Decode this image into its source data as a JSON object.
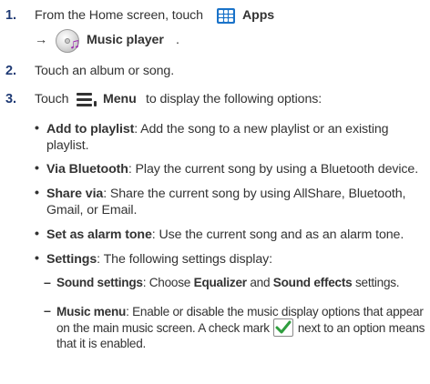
{
  "steps": [
    {
      "num": "1.",
      "pre": "From the Home screen, touch",
      "apps": "Apps",
      "arrow": "→",
      "music": "Music player",
      "end": "."
    },
    {
      "num": "2.",
      "text": "Touch an album or song."
    },
    {
      "num": "3.",
      "pre": "Touch",
      "menu": "Menu",
      "post": "to display the following options:"
    }
  ],
  "options": [
    {
      "bullet": "•",
      "label": "Add to playlist",
      "desc": ": Add the song to a new playlist or an existing playlist."
    },
    {
      "bullet": "•",
      "label": "Via Bluetooth",
      "desc": ": Play the current song by using a Bluetooth device."
    },
    {
      "bullet": "•",
      "label": "Share via",
      "desc": ": Share the current song by using AllShare, Bluetooth, Gmail, or Email."
    },
    {
      "bullet": "•",
      "label": "Set as alarm tone",
      "desc": ": Use the current song and as an alarm tone."
    },
    {
      "bullet": "•",
      "label": "Settings",
      "desc": ": The following settings display:"
    }
  ],
  "settings": [
    {
      "dash": "–",
      "label": "Sound settings",
      "d1": ": Choose ",
      "b1": "Equalizer",
      "d2": " and ",
      "b2": "Sound effects",
      "d3": " settings."
    },
    {
      "dash": "–",
      "label": "Music menu",
      "d1": ": Enable or disable the music display options that appear on the main music screen. A check mark",
      "d2": "next to an option means that it is enabled."
    }
  ],
  "icons": {
    "apps": "apps-grid-icon",
    "music": "music-player-icon",
    "menu": "menu-icon",
    "check": "check-mark-icon"
  }
}
